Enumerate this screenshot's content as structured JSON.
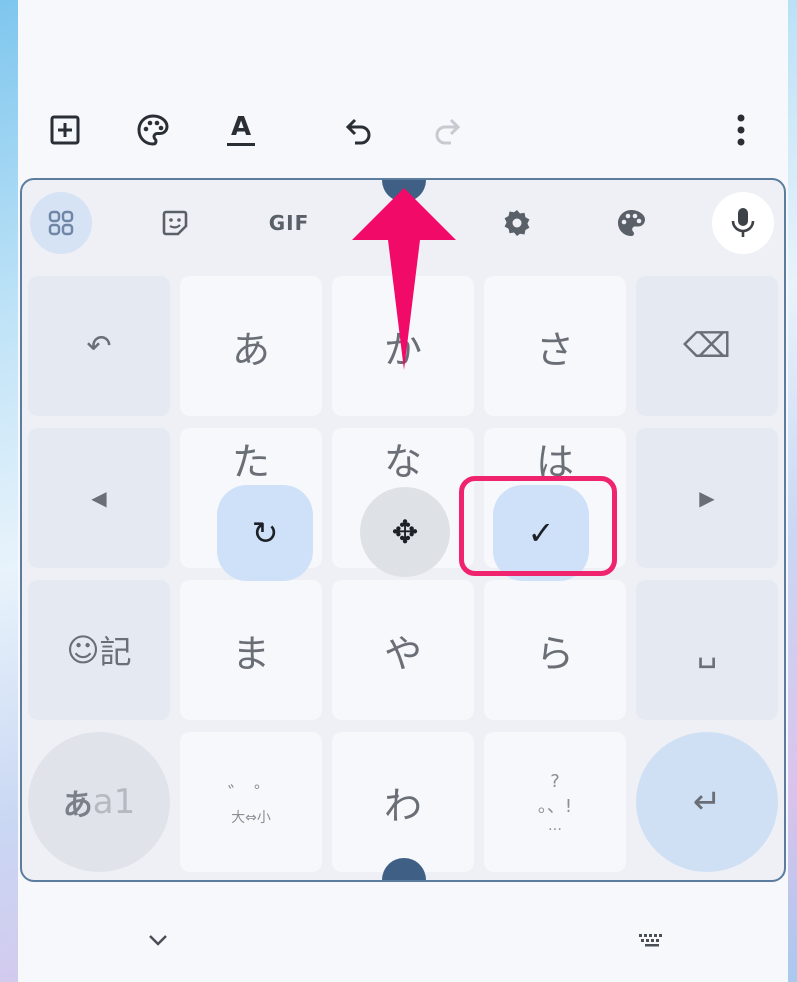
{
  "toolbar": {
    "icons": [
      "add-box-icon",
      "palette-icon",
      "text-format-icon",
      "undo-icon",
      "redo-icon",
      "more-vert-icon"
    ],
    "text_format_glyph": "A"
  },
  "keyboard_top": {
    "gif_label": "GIF",
    "icons": [
      "apps-grid-icon",
      "sticker-icon",
      "gif-icon",
      "settings-gear-icon",
      "palette-icon",
      "microphone-icon"
    ]
  },
  "keys": {
    "row1": {
      "undo": "↶",
      "a": "あ",
      "ka": "か",
      "sa": "さ",
      "backspace": "⌫"
    },
    "row2": {
      "left": "◀",
      "ta": "た",
      "na": "な",
      "ha": "は",
      "right": "▶"
    },
    "row3": {
      "symbol_face": "☺",
      "symbol_kanji": "記",
      "ma": "ま",
      "ya": "や",
      "ra": "ら",
      "space": "␣"
    },
    "row4": {
      "mode_hira": "あ",
      "mode_alpha": "a1",
      "dakuten_top": "゛ ゜",
      "dakuten_bottom": "大⇔小",
      "wa": "わ",
      "punct_top": "?",
      "punct_mid": "。、!",
      "punct_bottom": "…",
      "enter": "↵"
    }
  },
  "overlay": {
    "rotate_icon": "↻",
    "move_icon": "✥",
    "check_icon": "✓"
  },
  "bottom_bar": {
    "collapse_icon": "⌵",
    "keyboard_icon": "⌨"
  },
  "colors": {
    "handle": "#3f5f85",
    "highlight": "#f0236f",
    "arrow": "#f20a69"
  }
}
